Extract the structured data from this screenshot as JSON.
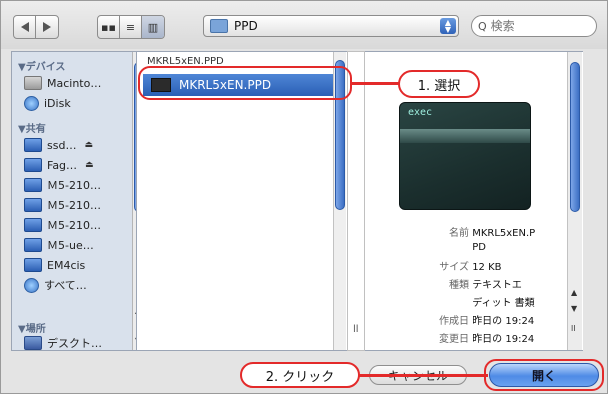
{
  "toolbar": {
    "path": "PPD",
    "search_placeholder": "検索"
  },
  "sidebar": {
    "devices_header": "▼デバイス",
    "devices": [
      {
        "label": "Macinto…"
      },
      {
        "label": "iDisk"
      }
    ],
    "shared_header": "▼共有",
    "shared": [
      {
        "label": "ssd…"
      },
      {
        "label": "Fag…"
      },
      {
        "label": "Ｍ5-210…"
      },
      {
        "label": "Ｍ5-210…"
      },
      {
        "label": "Ｍ5-210…"
      },
      {
        "label": "Ｍ5-ue…"
      },
      {
        "label": "EM4cis"
      },
      {
        "label": "すべて…"
      }
    ],
    "places_header": "▼場所",
    "places": [
      {
        "label": "デスクト…"
      }
    ]
  },
  "file_list": {
    "partial_top": "MKRL5xEN.PPD",
    "selected_file": "MKRL5xEN.PPD"
  },
  "preview": {
    "thumb_label": "exec",
    "meta": [
      {
        "key": "名前",
        "value": "MKRL5xEN.P"
      },
      {
        "key": "",
        "value": "PD"
      },
      {
        "key": "サイズ",
        "value": "12 KB"
      },
      {
        "key": "種類",
        "value": "テキストエ"
      },
      {
        "key": "",
        "value": "ディット 書類"
      },
      {
        "key": "作成日",
        "value": "昨日の 19:24"
      },
      {
        "key": "変更日",
        "value": "昨日の 19:24"
      }
    ]
  },
  "buttons": {
    "cancel": "キャンセル",
    "open": "開く"
  },
  "annotations": {
    "step1": "1. 選択",
    "step2": "2. クリック"
  },
  "colors": {
    "annotation": "#e32a2a",
    "selection": "#2a5fb5"
  }
}
